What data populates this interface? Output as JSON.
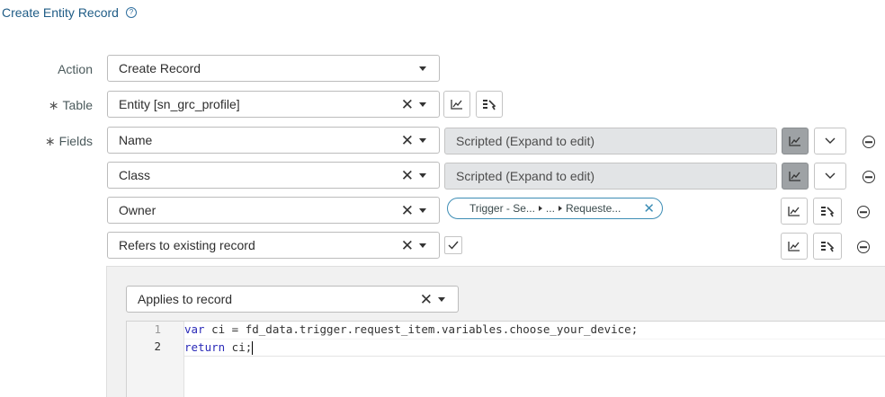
{
  "header": {
    "title": "Create Entity Record",
    "help_icon": "question-circle-icon"
  },
  "form": {
    "action": {
      "label": "Action",
      "value": "Create Record"
    },
    "table": {
      "label": "Table",
      "required_mark": "∗",
      "value": "Entity [sn_grc_profile]"
    },
    "fields": {
      "label": "Fields",
      "required_mark": "∗",
      "rows": [
        {
          "name": "Name",
          "value_text": "Scripted (Expand to edit)"
        },
        {
          "name": "Class",
          "value_text": "Scripted (Expand to edit)"
        },
        {
          "name": "Owner",
          "pill": {
            "segment1": "Trigger - Se...",
            "segment2": "...",
            "segment3": "Requeste..."
          }
        },
        {
          "name": "Refers to existing record",
          "checked": true
        }
      ]
    }
  },
  "script_panel": {
    "applies_to": "Applies to record",
    "code_lines": [
      {
        "number": "1",
        "keyword": "var",
        "rest": " ci = fd_data.trigger.request_item.variables.choose_your_device;"
      },
      {
        "number": "2",
        "keyword": "return",
        "rest": " ci;"
      }
    ]
  },
  "colors": {
    "title": "#1f5c86",
    "pill_border": "#3d8db5",
    "scripted_bg": "#e2e4e6",
    "active_button": "#9ea2a5"
  }
}
